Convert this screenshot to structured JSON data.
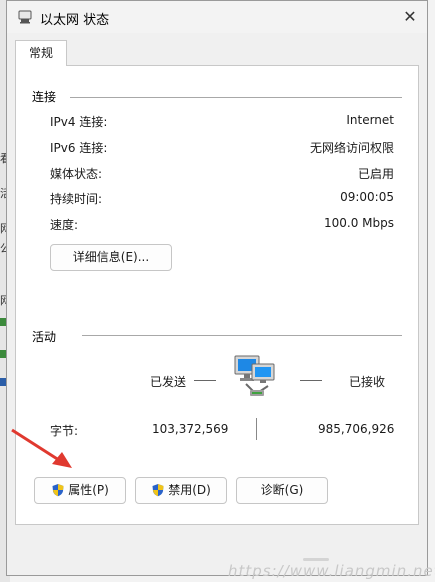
{
  "window": {
    "title": "以太网 状态",
    "close_glyph": "✕"
  },
  "tabs": [
    {
      "label": "常规"
    }
  ],
  "connection": {
    "section_title": "连接",
    "rows": [
      {
        "label": "IPv4 连接:",
        "value": "Internet"
      },
      {
        "label": "IPv6 连接:",
        "value": "无网络访问权限"
      },
      {
        "label": "媒体状态:",
        "value": "已启用"
      },
      {
        "label": "持续时间:",
        "value": "09:00:05"
      },
      {
        "label": "速度:",
        "value": "100.0 Mbps"
      }
    ],
    "details_button": "详细信息(E)..."
  },
  "activity": {
    "section_title": "活动",
    "sent_label": "已发送",
    "received_label": "已接收",
    "bytes_label": "字节:",
    "bytes_sent": "103,372,569",
    "bytes_received": "985,706,926"
  },
  "buttons": {
    "properties": "属性(P)",
    "disable": "禁用(D)",
    "diagnose": "诊断(G)"
  },
  "background_fragments": [
    "看",
    "活",
    "网",
    "公",
    "网"
  ],
  "watermark": "https://www.liangmin.net",
  "colors": {
    "shield_blue": "#2a63c9",
    "shield_yellow": "#f0c419",
    "arrow_red": "#e0392f",
    "monitor_blue": "#1e88e5"
  }
}
